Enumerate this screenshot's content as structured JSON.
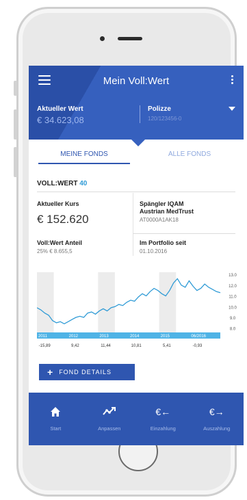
{
  "header": {
    "title": "Mein Voll:Wert"
  },
  "summary": {
    "value_label": "Aktueller Wert",
    "value_amount": "€ 34.623,08",
    "policy_label": "Polizze",
    "policy_value": "120/123456-0"
  },
  "tabs": [
    {
      "label": "MEINE FONDS",
      "active": true
    },
    {
      "label": "ALLE FONDS",
      "active": false
    }
  ],
  "section": {
    "title": "VOLL:WERT",
    "count": "40"
  },
  "fund": {
    "price_label": "Aktueller Kurs",
    "price_value": "€ 152.620",
    "name_line1": "Spängler IQAM",
    "name_line2": "Austrian MedTrust",
    "isin": "AT0000A1AK18",
    "share_label": "Voll:Wert Anteil",
    "share_value": "25%  € 8.655,5",
    "since_label": "Im Portfolio seit",
    "since_value": "01.10.2016"
  },
  "chart_data": {
    "type": "line",
    "x": [
      "2011",
      "2012",
      "2013",
      "2014",
      "2015",
      "06/2016"
    ],
    "yticks": [
      "13.0",
      "12.0",
      "11.0",
      "10.0",
      "9.0",
      "8.0"
    ],
    "ylim": [
      7.6,
      13.2
    ],
    "series": [
      {
        "values": [
          9.9,
          9.7,
          9.4,
          9.2,
          8.7,
          8.5,
          8.6,
          8.4,
          8.6,
          8.8,
          9.0,
          9.1,
          9.0,
          9.4,
          9.5,
          9.3,
          9.6,
          9.8,
          9.6,
          9.9,
          10.0,
          10.2,
          10.1,
          10.4,
          10.6,
          10.5,
          10.9,
          11.2,
          11.0,
          11.4,
          11.7,
          11.5,
          11.2,
          11.0,
          11.5,
          12.2,
          12.6,
          12.0,
          11.8,
          12.4,
          11.9,
          11.5,
          11.7,
          12.1,
          11.8,
          11.6,
          11.4,
          11.3
        ],
        "color": "#2f9bd6"
      }
    ],
    "returns": [
      "-15,89",
      "9,42",
      "11,44",
      "10,81",
      "5,41",
      "-0,93"
    ],
    "grid": false
  },
  "actions": {
    "fund_details": "FOND DETAILS"
  },
  "bottom_nav": [
    {
      "label": "Start",
      "icon": "home-icon"
    },
    {
      "label": "Anpassen",
      "icon": "adjust-icon"
    },
    {
      "label": "Einzahlung",
      "icon": "deposit-icon"
    },
    {
      "label": "Auszahlung",
      "icon": "withdrawal-icon"
    }
  ],
  "colors": {
    "primary": "#2f56b0",
    "accent": "#2f9bd6"
  }
}
